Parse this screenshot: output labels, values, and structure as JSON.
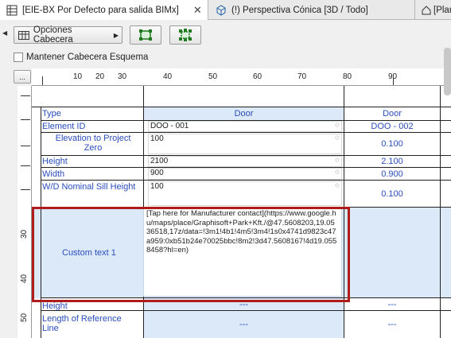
{
  "tabs": [
    {
      "label": "[EIE-BX Por Defecto para salida BIMx]",
      "close": "✕",
      "icon": "table-icon"
    },
    {
      "label": "(!) Perspectiva Cónica [3D / Todo]",
      "icon": "3d-view-icon"
    },
    {
      "label": "[Planta",
      "icon": "floor-plan-icon"
    }
  ],
  "toolbar": {
    "header_options_label": "Opciones Cabecera",
    "keep_header_label": "Mantener Cabecera Esquema",
    "ruler_button_label": "..."
  },
  "ruler": {
    "h_numbers": [
      "10",
      "20",
      "30",
      "40",
      "50",
      "60",
      "70",
      "80",
      "90"
    ],
    "v_numbers": [
      "30",
      "40",
      "50"
    ]
  },
  "schedule": {
    "rows": [
      {
        "label": "Type",
        "col1": "Door",
        "col2": "Door"
      },
      {
        "label": "Element ID",
        "col1": "DOO - 001",
        "col2": "DOO - 002"
      },
      {
        "label": "Elevation to Project Zero",
        "col1": "100",
        "col2": "0.100"
      },
      {
        "label": "Height",
        "col1": "2100",
        "col2": "2.100"
      },
      {
        "label": "Width",
        "col1": "900",
        "col2": "0.900"
      },
      {
        "label": "W/D Nominal Sill Height",
        "col1": "100",
        "col2": "0.100"
      },
      {
        "label": "Custom text 1",
        "col1": "[Tap here for Manufacturer contact](https://www.google.hu/maps/place/Graphisoft+Park+Kft./@47.5608203,19.0536518,17z/data=!3m1!4b1!4m5!3m4!1s0x4741d9823c47a959:0xb51b24e70025bbc!8m2!3d47.5608167!4d19.0558458?hl=en)",
        "col2": ""
      },
      {
        "label": "Height",
        "col1": "---",
        "col2": "---"
      },
      {
        "label": "Length of Reference Line",
        "col1": "---",
        "col2": "---"
      }
    ]
  },
  "colors": {
    "accent_text": "#2a4dbd",
    "highlight_border": "#b01c1c",
    "selected_fill": "#dbe9f8"
  }
}
